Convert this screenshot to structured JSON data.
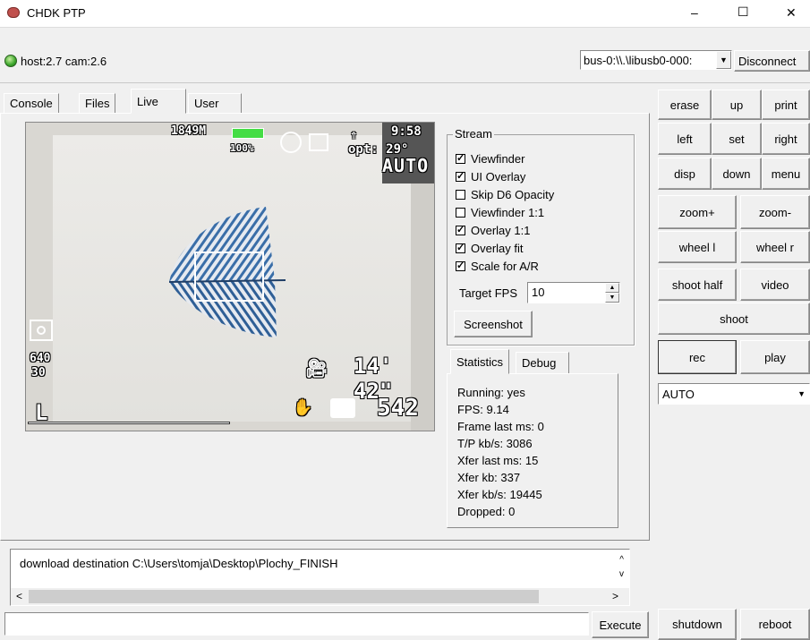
{
  "window": {
    "title": "CHDK PTP",
    "minimize": "–",
    "maximize": "☐",
    "close": "✕"
  },
  "status": {
    "text": "host:2.7 cam:2.6",
    "device": "bus-0:\\\\.\\libusb0-000:",
    "disconnect": "Disconnect"
  },
  "tabs": [
    "Console",
    "Files",
    "Live",
    "User"
  ],
  "live": {
    "memory": "1849M",
    "battery": "100%",
    "time": "9:58",
    "opt": "opt: 29°",
    "mode": "AUTO",
    "resolution_top": "640",
    "resolution_bottom": "30",
    "rec_time": "14' 42\"",
    "shots": "542",
    "quality": "L"
  },
  "stream": {
    "legend": "Stream",
    "options": [
      {
        "label": "Viewfinder",
        "checked": true
      },
      {
        "label": "UI Overlay",
        "checked": true
      },
      {
        "label": "Skip D6 Opacity",
        "checked": false
      },
      {
        "label": "Viewfinder 1:1",
        "checked": false
      },
      {
        "label": "Overlay 1:1",
        "checked": true
      },
      {
        "label": "Overlay fit",
        "checked": true
      },
      {
        "label": "Scale for A/R",
        "checked": true
      }
    ],
    "fps_label": "Target FPS",
    "fps_value": "10",
    "screenshot": "Screenshot"
  },
  "stats_tabs": [
    "Statistics",
    "Debug"
  ],
  "stats": [
    "Running: yes",
    "FPS: 9.14",
    "Frame last ms: 0",
    "T/P kb/s: 3086",
    "Xfer last ms: 15",
    "Xfer kb: 337",
    "Xfer kb/s: 19445",
    "Dropped: 0"
  ],
  "console": {
    "text": "download destination C:\\Users\\tomja\\Desktop\\Plochy_FINISH",
    "input_value": "",
    "execute": "Execute"
  },
  "keys": {
    "erase": "erase",
    "up": "up",
    "print": "print",
    "left": "left",
    "set": "set",
    "right": "right",
    "disp": "disp",
    "down": "down",
    "menu": "menu",
    "zoom_in": "zoom+",
    "zoom_out": "zoom-",
    "wheel_l": "wheel l",
    "wheel_r": "wheel r",
    "shoot_half": "shoot half",
    "video": "video",
    "shoot": "shoot",
    "rec": "rec",
    "play": "play",
    "mode": "AUTO",
    "shutdown": "shutdown",
    "reboot": "reboot"
  }
}
